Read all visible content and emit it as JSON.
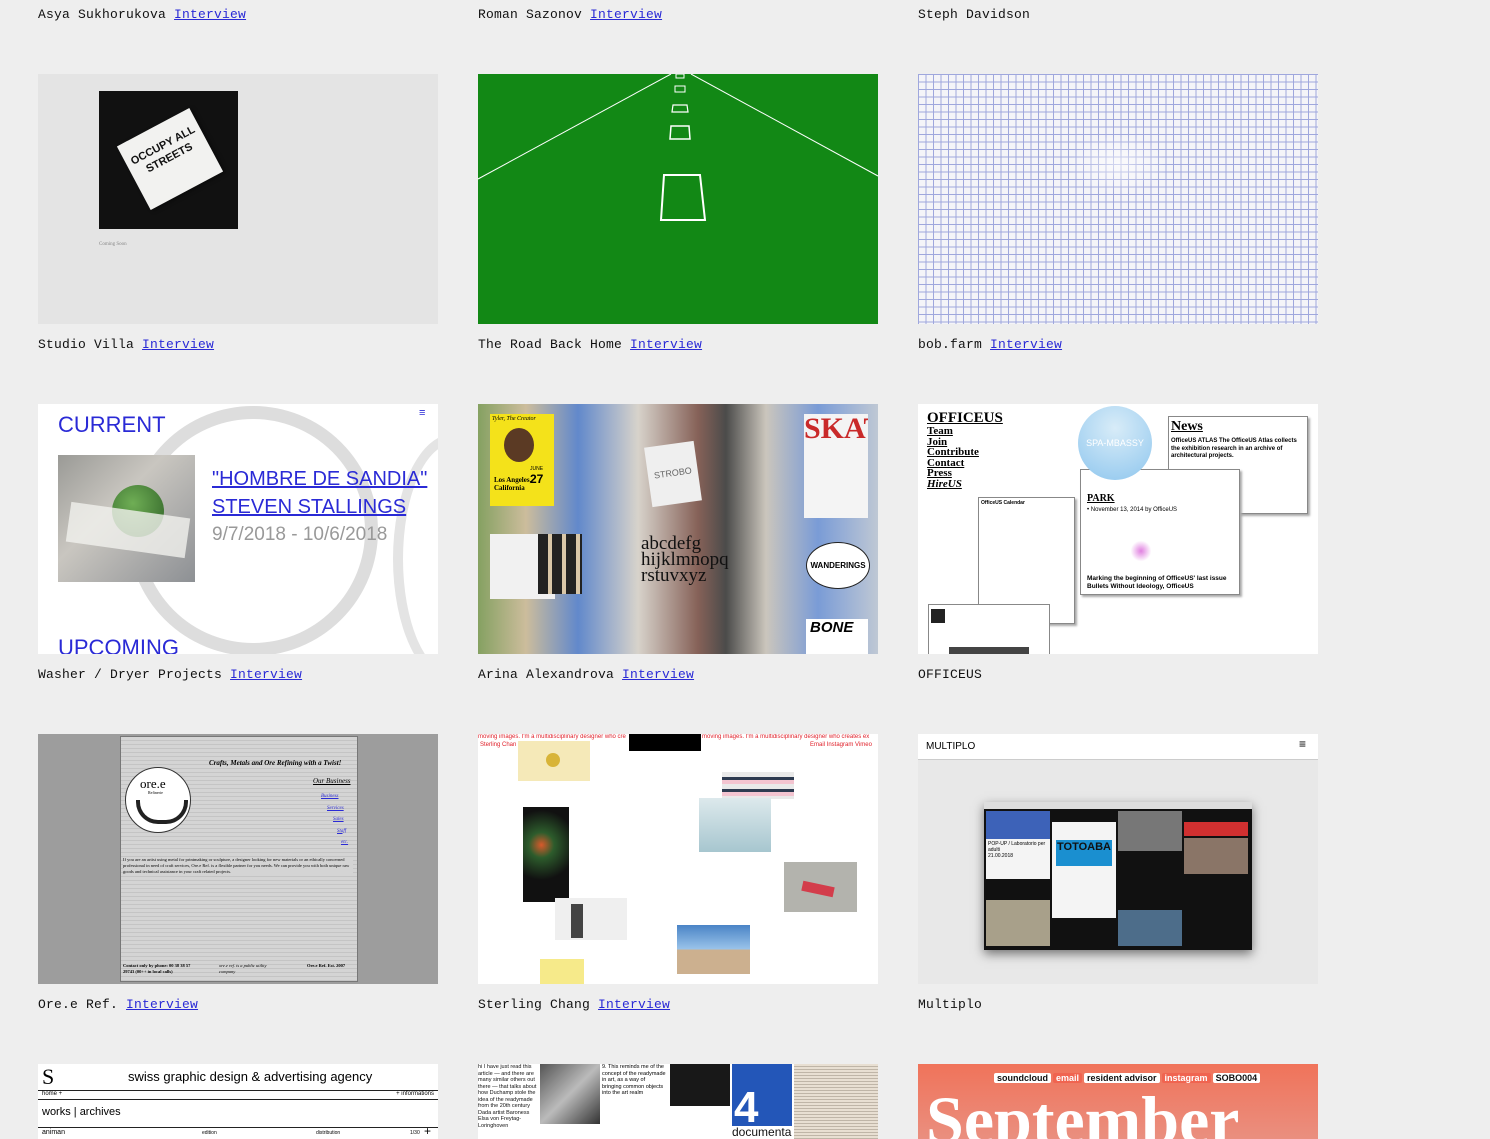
{
  "top_row": [
    {
      "name": "Asya Sukhorukova",
      "link": "Interview"
    },
    {
      "name": "Roman Sazonov",
      "link": "Interview"
    },
    {
      "name": "Steph Davidson",
      "link": ""
    }
  ],
  "projects": [
    {
      "name": "Studio Villa",
      "link": "Interview"
    },
    {
      "name": "The Road Back Home",
      "link": "Interview"
    },
    {
      "name": "bob.farm",
      "link": "Interview"
    },
    {
      "name": "Washer / Dryer Projects",
      "link": "Interview"
    },
    {
      "name": "Arina Alexandrova",
      "link": "Interview"
    },
    {
      "name": "OFFICEUS",
      "link": ""
    },
    {
      "name": "Ore.e Ref.",
      "link": "Interview"
    },
    {
      "name": "Sterling Chang",
      "link": "Interview"
    },
    {
      "name": "Multiplo",
      "link": ""
    }
  ],
  "thumbs": {
    "studio_villa": {
      "poster_text": "OCCUPY ALL STREETS",
      "small_text": "Coming Soon"
    },
    "washer": {
      "current": "CURRENT",
      "title1": "\"HOMBRE DE SANDIA\"",
      "title2": "STEVEN STALLINGS",
      "dates": "9/7/2018 - 10/6/2018",
      "upcoming": "UPCOMING"
    },
    "arina": {
      "label1": "Tyler, The Creator",
      "label2": "Los Angeles, California",
      "june": "JUNE",
      "day": "27",
      "skate": "SKATE!",
      "wanderings": "WANDERINGS",
      "alphabet1": "abcdefg",
      "alphabet2": "hijklmnopq",
      "alphabet3": "rstuvxyz",
      "bone": "BONE",
      "strobo": "STROBO"
    },
    "officeus": {
      "logo": "OFFICEUS",
      "menu": [
        "Team",
        "Join",
        "Contribute",
        "Contact",
        "Press",
        "HireUS"
      ],
      "badge": "SPA-MBASSY",
      "news_title": "News",
      "news_body": "OfficeUS ATLAS The OfficeUS Atlas collects the exhibition research in an archive of architectural projects.",
      "park": "PARK",
      "park_date": "• November 13, 2014 by OfficeUS",
      "park_text": "Marking the beginning of OfficeUS' last issue Bullets Without Ideology, OfficeUS",
      "calendar": "OfficeUS Calendar"
    },
    "oree": {
      "header": "Crafts, Metals and Ore Refining with a Twist!",
      "business": "Our Business",
      "links": [
        "Business",
        "Services",
        "Sales",
        "Staff",
        "etc."
      ],
      "logo": "ore.e",
      "logo_sub": "Refinerie",
      "body": "If you are an artist using metal for printmaking or sculpture, a designer looking for new materials or an ethically concerned professional in need of craft services, Ore.e Ref. is a flexible partner for you needs. We can provide you with both unique raw goods and technical assistance in your craft related projects.",
      "footer_contact": "Contact only by phone: 00 38 38 57 29743 (00++ in local calls)",
      "footer_mid": "ore.e ref. is a public utility company",
      "footer_right": "Ore.e Ref. Est. 2007"
    },
    "sterling": {
      "marquee1": "moving images. I'm a multidisciplinary designer who cre",
      "marquee2": "moving images. I'm a multidisciplinary designer who creates ex",
      "name": "Sterling Chan",
      "links": "Email Instagram Vimeo"
    },
    "multiplo": {
      "logo": "MULTIPLO",
      "inner_title": "TOTOABA",
      "event": "POP-UP / Laboratorio per adulti",
      "event_time": "21.00.2018"
    }
  },
  "bottom_row": {
    "swiss": {
      "title": "swiss graphic design & advertising agency",
      "home": "home +",
      "info": "+ informations",
      "works": "works | archives",
      "col1": "animan",
      "col2": "edition",
      "col3": "distribution",
      "count": "1/30"
    },
    "article": {
      "text1": "hi I have just read this article — and there are many similar others out there — that talks about how Duchamp stole the idea of the readymade from the 20th century Dada artist Baroness Elsa von Freytag-Loringhoven",
      "text2": "9. This reminds me of the concept of the readymade in art, as a way of bringing common objects into the art realm",
      "big": "4",
      "documenta": "documenta"
    },
    "september": {
      "tags": [
        "soundcloud",
        "email",
        "resident advisor",
        "instagram",
        "SOBO004"
      ],
      "headline": "September"
    }
  }
}
